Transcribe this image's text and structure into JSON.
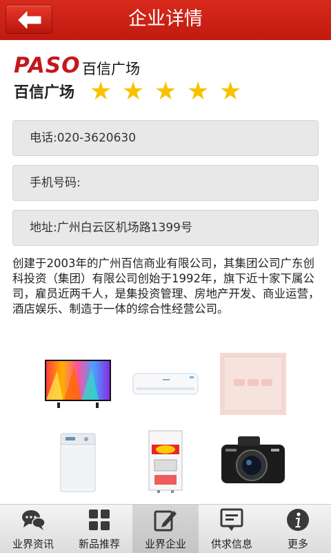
{
  "header": {
    "title": "企业详情",
    "back_icon": "back-arrow-icon"
  },
  "company": {
    "logo": {
      "brand": "PASO",
      "subtitle": "百信广场"
    },
    "name": "百信广场",
    "rating": {
      "stars": 5,
      "max": 5
    }
  },
  "fields": {
    "phone": "电话:020-3620630",
    "mobile": "手机号码:",
    "address": "地址:广州白云区机场路1399号"
  },
  "description": "创建于2003年的广州百信商业有限公司，其集团公司广东创科投资（集团）有限公司创始于1992年，旗下近十家下属公司，雇员近两千人，是集投资管理、房地产开发、商业运营，酒店娱乐、制造于一体的综合性经营公司。",
  "products": [
    {
      "icon": "television-image"
    },
    {
      "icon": "air-conditioner-image"
    },
    {
      "icon": "pink-panel-image"
    },
    {
      "icon": "washing-machine-image"
    },
    {
      "icon": "water-heater-image"
    },
    {
      "icon": "camera-image"
    }
  ],
  "nav": {
    "items": [
      {
        "label": "业界资讯",
        "icon": "chat-bubbles-icon"
      },
      {
        "label": "新品推荐",
        "icon": "grid-icon"
      },
      {
        "label": "业界企业",
        "icon": "edit-icon",
        "active": true
      },
      {
        "label": "供求信息",
        "icon": "message-board-icon"
      },
      {
        "label": "更多",
        "icon": "info-icon"
      }
    ]
  },
  "colors": {
    "header": "#c8201a",
    "star": "#f7c200",
    "logo_red": "#c3181d"
  }
}
